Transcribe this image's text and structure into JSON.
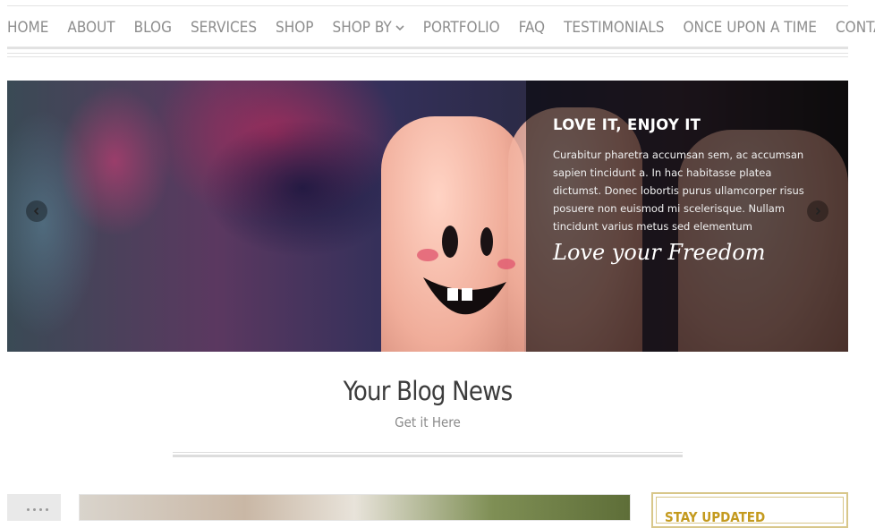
{
  "nav": {
    "items": [
      {
        "label": "HOME"
      },
      {
        "label": "ABOUT"
      },
      {
        "label": "BLOG"
      },
      {
        "label": "SERVICES"
      },
      {
        "label": "SHOP"
      },
      {
        "label": "SHOP BY",
        "has_dropdown": true
      },
      {
        "label": "PORTFOLIO"
      },
      {
        "label": "FAQ"
      },
      {
        "label": "TESTIMONIALS"
      },
      {
        "label": "ONCE UPON A TIME"
      },
      {
        "label": "CONTACT"
      }
    ]
  },
  "slider": {
    "title": "LOVE IT, ENJOY IT",
    "text": "Curabitur pharetra accumsan sem, ac accumsan sapien tincidunt a. In hac habitasse platea dictumst. Donec lobortis purus ullamcorper risus posuere non euismod mi scelerisque. Nullam tincidunt varius metus sed elementum",
    "script": "Love your Freedom",
    "prev_icon": "chevron-left-icon",
    "next_icon": "chevron-right-icon"
  },
  "section": {
    "title": "Your Blog News",
    "subtitle": "Get it Here"
  },
  "sidebar": {
    "widget_title": "STAY UPDATED"
  },
  "colors": {
    "nav_text": "#8d8d8d",
    "accent_gold": "#c49a1e",
    "widget_border": "#d8c78a"
  }
}
